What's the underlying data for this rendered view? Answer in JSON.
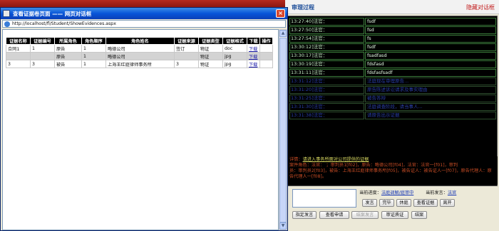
{
  "popup": {
    "title": "查看证据卷页面 —— 网页对话框",
    "close_glyph": "×",
    "address": "http://localhost/fl/Student/ShowEvidences.aspx",
    "table": {
      "headers": [
        "证据名称",
        "证据编号",
        "所属角色",
        "角色顺序",
        "角色姓名",
        "证据来源",
        "证据类型",
        "证据格式",
        "下载",
        "操作"
      ],
      "rows": [
        [
          "合同1",
          "1",
          "原告",
          "1",
          "略德公司",
          "签订",
          "物证",
          "doc",
          "下载",
          ""
        ],
        [
          "",
          "",
          "原告",
          "1",
          "略德公司",
          "",
          "物证",
          "jpg",
          "下载",
          ""
        ],
        [
          "3",
          "3",
          "被告",
          "1",
          "上海王红庭律师事务所",
          "3",
          "物证",
          "jpg",
          "下载",
          ""
        ]
      ]
    }
  },
  "right_panel": {
    "title": "审理过程",
    "hide_link": "隐藏对话框",
    "log": [
      {
        "time": "13:27:40]法官：",
        "msg": "fsdf",
        "dim": false
      },
      {
        "time": "13:27:50]法官：",
        "msg": "fsd",
        "dim": false
      },
      {
        "time": "13:27:54]法官：",
        "msg": "fs",
        "dim": false
      },
      {
        "time": "13:30:12]法官：",
        "msg": "fsdf",
        "dim": false
      },
      {
        "time": "13:30:17]法官：",
        "msg": "fsadfasd",
        "dim": false
      },
      {
        "time": "13:30:19]法官：",
        "msg": "fdsfasd",
        "dim": false
      },
      {
        "time": "13:31:11]法官：",
        "msg": "fdsfasfsadf",
        "dim": false
      },
      {
        "time": "13:31:12]法官：",
        "msg": "法庭现在审理原告...",
        "dim": true
      },
      {
        "time": "13:31:20]法官：",
        "msg": "原告陈述诉讼请求及事实理由",
        "dim": true
      },
      {
        "time": "13:31:25]法官：",
        "msg": "被告答辩",
        "dim": true
      },
      {
        "time": "13:31:30]法官：",
        "msg": "法庭调查阶段，请当事人...",
        "dim": true
      },
      {
        "time": "13:31:38]法官：",
        "msg": "请原告出示证据",
        "dim": true
      }
    ],
    "info_label": "详情：",
    "info_link": "请进入事务所面对公司提供的证据",
    "info_text_1": "案件角色：法官：   ；审判员1[f02]，原告：略德公司[f04]，法官：法官一[f01]，审判",
    "info_text_2": "员：审判员2[f03]，被告：上海王红庭律师事务所[f05]，被告证人：被告证人一[f07]，原告代理人：原告代理人一[f08]。",
    "stage_label": "当前进度：",
    "stage_value": "法庭调解/庭审中",
    "speaker_label": "当前发言：",
    "speaker_value": "法官",
    "buttons_row1": [
      "发言",
      "完毕",
      "休庭",
      "查看证据",
      "离开"
    ],
    "buttons_row2": [
      "指定发言",
      "查看申请",
      "结案发言",
      "审证质证",
      "结案"
    ]
  }
}
